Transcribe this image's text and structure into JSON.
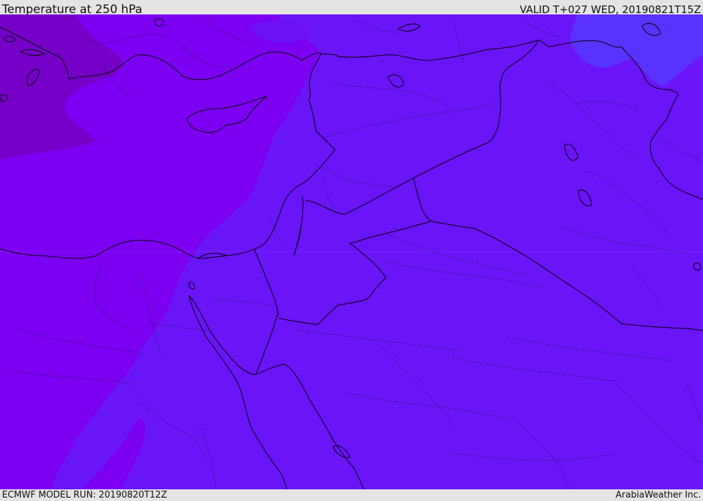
{
  "header": {
    "title": "Temperature at 250 hPa",
    "valid_time": "VALID T+027 WED, 20190821T15Z"
  },
  "footer": {
    "model_run": "ECMWF MODEL RUN: 20190820T12Z",
    "credit": "ArabiaWeather Inc."
  },
  "map": {
    "field": "temperature",
    "level": "250 hPa",
    "colors": {
      "coldest_band": "#7500c8",
      "cold_band": "#7c00f2",
      "mid_band": "#6a14f8",
      "warm_band": "#5a32ff",
      "border_line": "#000000",
      "region_line": "#333366"
    }
  }
}
